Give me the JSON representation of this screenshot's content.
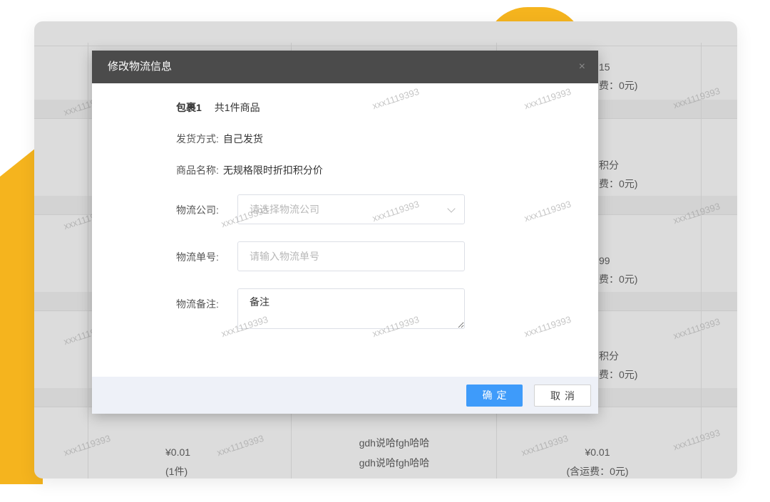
{
  "background": {
    "rows": [
      {
        "right_top": "15",
        "right_bottom": "费：0元)"
      },
      {
        "right_top": "积分",
        "right_bottom": "费：0元)"
      },
      {
        "right_top": "99",
        "right_bottom": "费：0元)"
      },
      {
        "right_top": "积分",
        "right_bottom": "费：0元)"
      }
    ],
    "last_row": {
      "price": "¥0.01",
      "quantity": "(1件)",
      "name_line1": "gdh说哈fgh哈哈",
      "name_line2": "gdh说哈fgh哈哈",
      "total": "¥0.01",
      "shipping": "(含运费：0元)"
    },
    "watermark_text": "xxx1119393"
  },
  "modal": {
    "title": "修改物流信息",
    "close_glyph": "×",
    "package": {
      "title": "包裹1",
      "count": "共1件商品"
    },
    "delivery_method": {
      "label": "发货方式:",
      "value": "自己发货"
    },
    "product_name": {
      "label": "商品名称:",
      "value": "无规格限时折扣积分价"
    },
    "logistics_company": {
      "label": "物流公司:",
      "placeholder": "请选择物流公司"
    },
    "tracking_number": {
      "label": "物流单号:",
      "placeholder": "请输入物流单号"
    },
    "remark": {
      "label": "物流备注:",
      "value": "备注"
    },
    "confirm_label": "确定",
    "cancel_label": "取消"
  },
  "colors": {
    "accent": "#3e9bfa",
    "decoration": "#f5b41e",
    "modal_header": "#4b4b4b"
  }
}
